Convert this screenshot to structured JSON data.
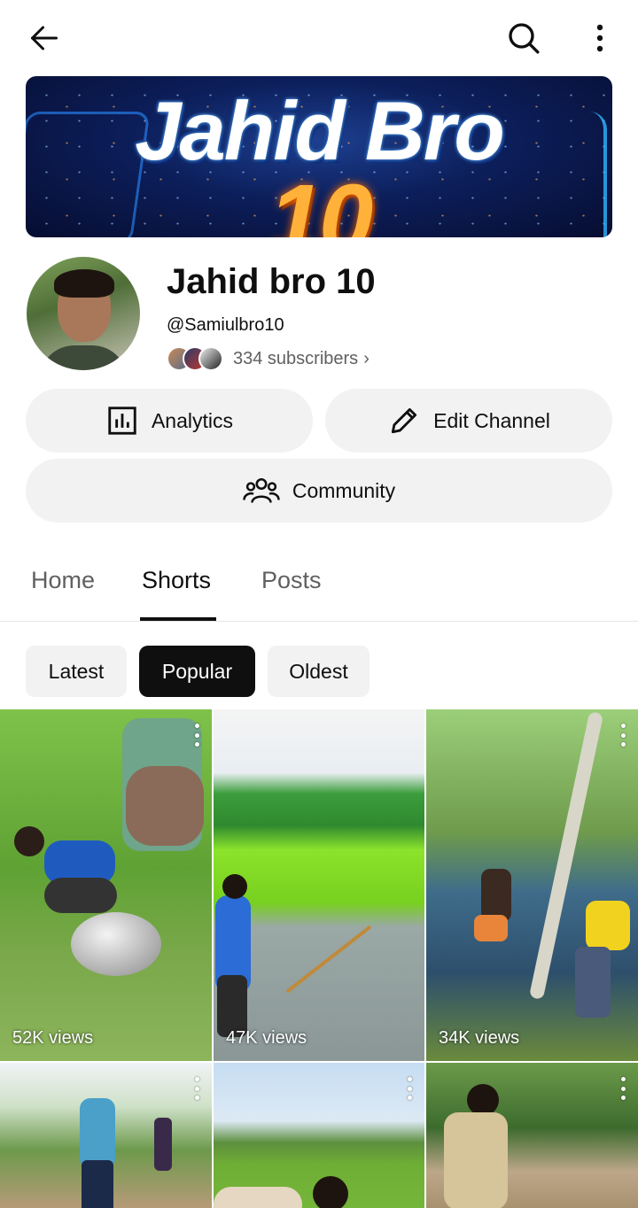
{
  "topbar": {
    "back_icon": "arrow-left-icon",
    "search_icon": "search-icon",
    "more_icon": "more-vertical-icon"
  },
  "banner": {
    "line1": "Jahid Bro",
    "line2": "10"
  },
  "channel": {
    "name": "Jahid bro 10",
    "handle": "@Samiulbro10",
    "subscribers": "334 subscribers",
    "chevron": "›"
  },
  "actions": {
    "analytics_label": "Analytics",
    "edit_label": "Edit Channel",
    "community_label": "Community"
  },
  "tabs": [
    {
      "label": "Home",
      "selected": false
    },
    {
      "label": "Shorts",
      "selected": true
    },
    {
      "label": "Posts",
      "selected": false
    }
  ],
  "filters": [
    {
      "label": "Latest",
      "selected": false
    },
    {
      "label": "Popular",
      "selected": true
    },
    {
      "label": "Oldest",
      "selected": false
    }
  ],
  "shorts": [
    {
      "views": "52K views"
    },
    {
      "views": "47K views"
    },
    {
      "views": "34K views"
    },
    {
      "views": ""
    },
    {
      "views": ""
    },
    {
      "views": ""
    }
  ],
  "colors": {
    "text": "#0f0f0f",
    "secondary_text": "#606060",
    "chip_bg": "#f2f2f2",
    "selected_chip_bg": "#0f0f0f"
  }
}
